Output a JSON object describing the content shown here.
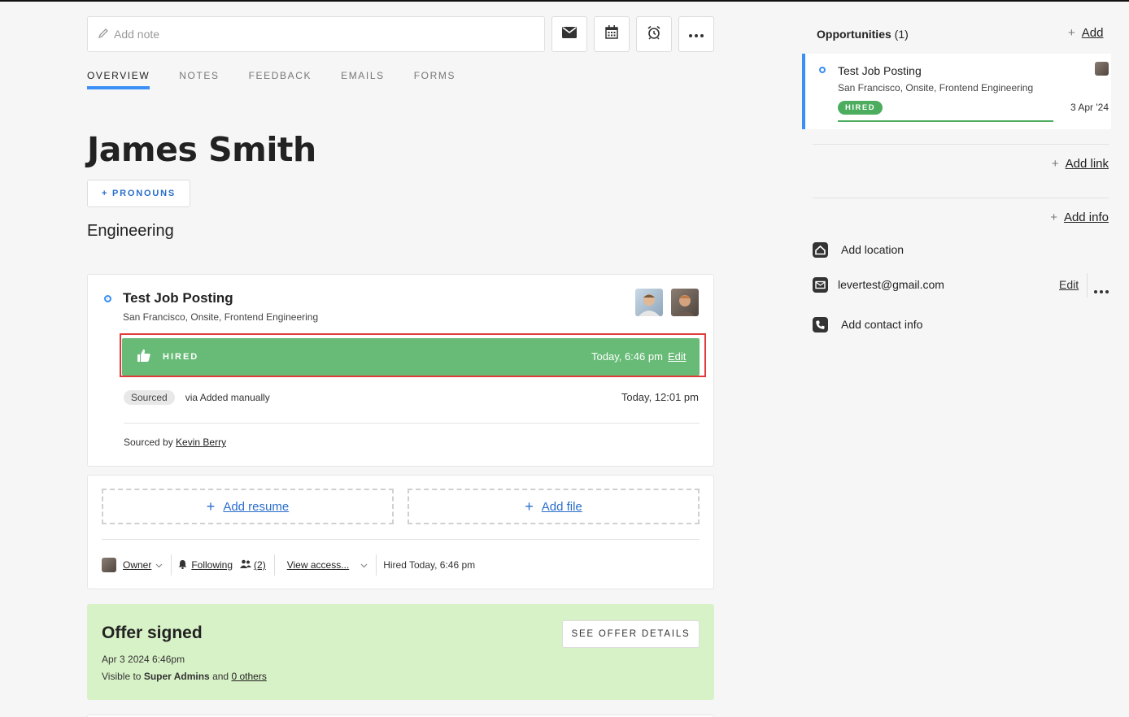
{
  "toolbar": {
    "note_placeholder": "Add note"
  },
  "tabs": [
    {
      "label": "OVERVIEW"
    },
    {
      "label": "NOTES"
    },
    {
      "label": "FEEDBACK"
    },
    {
      "label": "EMAILS"
    },
    {
      "label": "FORMS"
    }
  ],
  "candidate": {
    "name": "James Smith",
    "pronouns_button": "+ PRONOUNS",
    "headline": "Engineering"
  },
  "opportunity": {
    "title": "Test Job Posting",
    "subtitle": "San Francisco, Onsite, Frontend Engineering",
    "stage": "HIRED",
    "stage_time": "Today, 6:46 pm",
    "edit_label": "Edit",
    "source_pill": "Sourced",
    "source_via": "via Added manually",
    "source_time": "Today, 12:01 pm",
    "sourced_by_prefix": "Sourced by",
    "sourced_by_name": "Kevin Berry"
  },
  "files": {
    "add_resume": "Add resume",
    "add_file": "Add file",
    "owner_label": "Owner",
    "following_label": "Following",
    "followers_count": "(2)",
    "view_access": "View access...",
    "hired_status": "Hired Today, 6:46 pm"
  },
  "offer": {
    "title": "Offer signed",
    "date": "Apr 3 2024 6:46pm",
    "visible_prefix": "Visible to",
    "visible_group": "Super Admins",
    "visible_and": "and",
    "visible_others": "0 others",
    "details_button": "SEE OFFER DETAILS"
  },
  "sidebar": {
    "opportunities_title": "Opportunities",
    "opportunities_count": "(1)",
    "add_label": "Add",
    "opp_title": "Test Job Posting",
    "opp_subtitle": "San Francisco, Onsite, Frontend Engineering",
    "opp_stage": "HIRED",
    "opp_date": "3 Apr '24",
    "add_link": "Add link",
    "add_info": "Add info",
    "add_location": "Add location",
    "email": "levertest@gmail.com",
    "email_edit": "Edit",
    "add_contact": "Add contact info"
  },
  "colors": {
    "accent": "#3b8ff6",
    "hired_green": "#67bb76",
    "offer_bg": "#d8f2c7",
    "highlight_red": "#e03a3a"
  }
}
